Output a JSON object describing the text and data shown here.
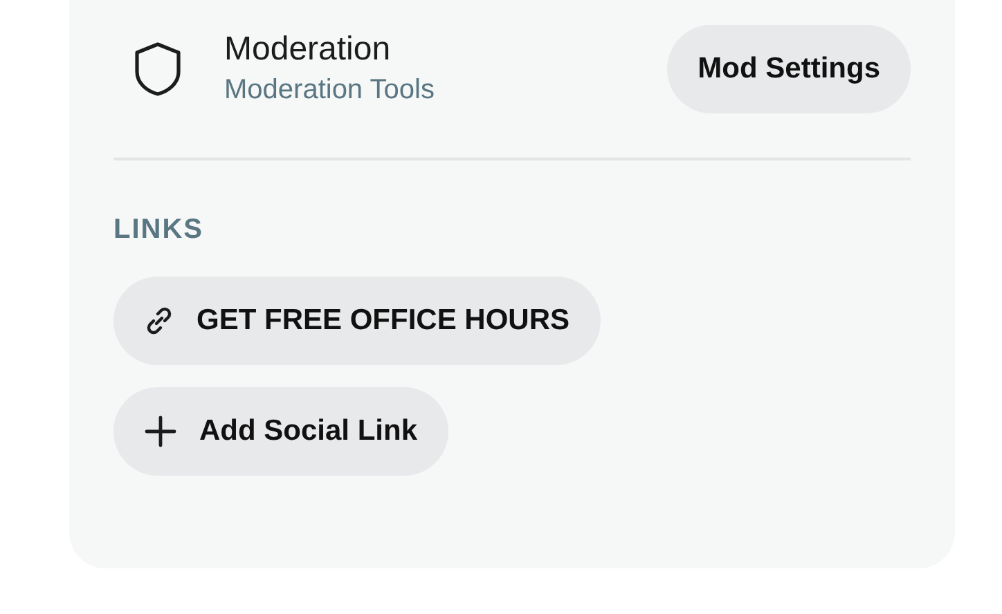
{
  "moderation": {
    "title": "Moderation",
    "subtitle": "Moderation Tools",
    "button": "Mod Settings"
  },
  "links": {
    "heading": "LINKS",
    "items": [
      {
        "kind": "link",
        "label": "GET FREE OFFICE HOURS"
      },
      {
        "kind": "add",
        "label": "Add Social Link"
      }
    ]
  }
}
